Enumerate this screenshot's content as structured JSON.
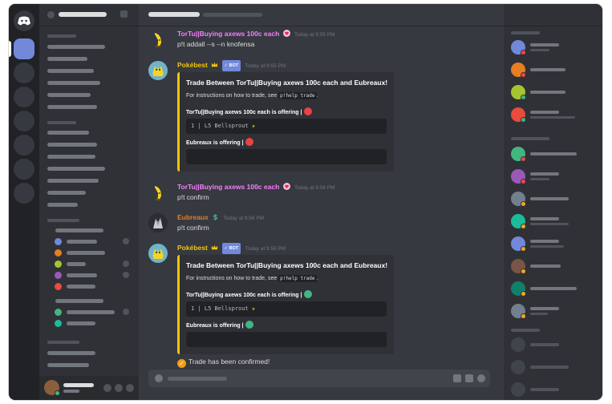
{
  "colors": {
    "blurple": "#7289da",
    "bot_yellow": "#f1c40f",
    "user_pink": "#f47fff",
    "user_orange": "#e67e22",
    "red_mark": "#ed4245",
    "green_mark": "#43b581"
  },
  "messages": [
    {
      "author": "TorTu||Buying axews 100c each",
      "badge_icon": "heart-badge-icon",
      "timestamp": "Today at 9:55 PM",
      "text": "p!t addall --s --n knofensa"
    },
    {
      "author": "Pokébest",
      "crown_icon": "crown-icon",
      "bot_tag": "✓ BOT",
      "timestamp": "Today at 9:55 PM",
      "embed": {
        "title": "Trade Between TorTu||Buying axews 100c each and Eubreaux!",
        "desc_prefix": "For instructions on how to trade, see ",
        "desc_code": "p!help trade",
        "desc_suffix": ".",
        "field1_name": "TorTu||Buying axews 100c each is offering |",
        "field1_status": "red",
        "field1_value": "1 | L5 Bellsprout ",
        "field1_star": "★",
        "field2_name": "Eubreaux is offering |",
        "field2_status": "red"
      }
    },
    {
      "author": "TorTu||Buying axews 100c each",
      "timestamp": "Today at 9:56 PM",
      "text": "p!t confirm"
    },
    {
      "author": "Eubreaux",
      "badge_icon": "dollar-badge-icon",
      "timestamp": "Today at 9:56 PM",
      "text": "p!t confirm"
    },
    {
      "author": "Pokébest",
      "bot_tag": "✓ BOT",
      "timestamp": "Today at 9:56 PM",
      "embed": {
        "title": "Trade Between TorTu||Buying axews 100c each and Eubreaux!",
        "desc_prefix": "For instructions on how to trade, see ",
        "desc_code": "p!help trade",
        "desc_suffix": ".",
        "field1_name": "TorTu||Buying axews 100c each is offering |",
        "field1_status": "green",
        "field1_value": "1 | L5 Bellsprout ",
        "field1_star": "★",
        "field2_name": "Eubreaux is offering |",
        "field2_status": "green"
      },
      "confirm_text": "Trade has been confirmed!"
    }
  ]
}
